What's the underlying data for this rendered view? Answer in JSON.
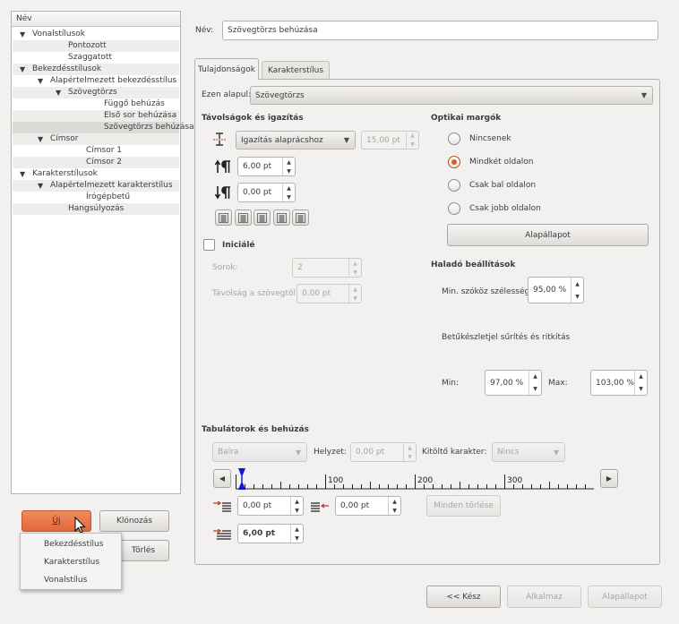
{
  "style_list": {
    "header": "Név",
    "rows": [
      {
        "label": "Vonalstílusok",
        "level": 0,
        "expander": true
      },
      {
        "label": "Pontozott",
        "level": 2
      },
      {
        "label": "Szaggatott",
        "level": 2
      },
      {
        "label": "Bekezdésstílusok",
        "level": 0,
        "expander": true
      },
      {
        "label": "Alapértelmezett bekezdésstílus",
        "level": 1,
        "expander": true
      },
      {
        "label": "Szövegtörzs",
        "level": 2,
        "expander": true
      },
      {
        "label": "Függő behúzás",
        "level": 4
      },
      {
        "label": "Első sor behúzása",
        "level": 4
      },
      {
        "label": "Szövegtörzs behúzása",
        "level": 4,
        "selected": true
      },
      {
        "label": "Címsor",
        "level": 1,
        "expander": true
      },
      {
        "label": "Címsor 1",
        "level": 3
      },
      {
        "label": "Címsor 2",
        "level": 3
      },
      {
        "label": "Karakterstílusok",
        "level": 0,
        "expander": true
      },
      {
        "label": "Alapértelmezett karakterstílus",
        "level": 1,
        "expander": true
      },
      {
        "label": "Írógépbetű",
        "level": 3
      },
      {
        "label": "Hangsúlyozás",
        "level": 2
      }
    ]
  },
  "left_buttons": {
    "new": "Új",
    "clone": "Klónozás",
    "delete": "Törlés"
  },
  "new_menu": {
    "items": [
      "Bekezdésstílus",
      "Karakterstílus",
      "Vonalstílus"
    ]
  },
  "name_label": "Név:",
  "name_value": "Szövegtörzs behúzása",
  "tabs": {
    "properties": "Tulajdonságok",
    "char_style": "Karakterstílus"
  },
  "based_on": {
    "label": "Ezen alapul:",
    "value": "Szövegtörzs"
  },
  "spacing": {
    "title": "Távolságok és igazítás",
    "line_spacing_mode": "Igazítás alaprácshoz",
    "line_spacing_value": "15,00 pt",
    "space_above": "6,00 pt",
    "space_below": "0,00 pt"
  },
  "dropcap": {
    "label": "Iniciálé",
    "lines_label": "Sorok:",
    "lines_value": "2",
    "distance_label": "Távolság a szövegtől:",
    "distance_value": "0,00 pt"
  },
  "optical": {
    "title": "Optikai margók",
    "options": [
      "Nincsenek",
      "Mindkét oldalon",
      "Csak bal oldalon",
      "Csak jobb oldalon"
    ],
    "selected_index": 1,
    "reset_label": "Alapállapot"
  },
  "advanced": {
    "title": "Haladó beállítások",
    "min_space_label": "Min. szóköz szélesség:",
    "min_space_value": "95,00 %",
    "glyph_title": "Betűkészletjel sűrítés és ritkítás",
    "min_label": "Min:",
    "min_value": "97,00 %",
    "max_label": "Max:",
    "max_value": "103,00 %"
  },
  "tabulators": {
    "title": "Tabulátorok és behúzás",
    "align_value": "Balra",
    "position_label": "Helyzet:",
    "position_value": "0,00 pt",
    "fill_label": "Kitöltő karakter:",
    "fill_value": "Nincs",
    "ruler_labels": [
      "100",
      "200",
      "300"
    ],
    "left_indent": "0,00 pt",
    "right_indent": "0,00 pt",
    "first_line_indent": "6,00 pt",
    "clear_all": "Minden törlése"
  },
  "bottom_buttons": {
    "back": "<< Kész",
    "apply": "Alkalmaz",
    "reset": "Alapállapot"
  }
}
